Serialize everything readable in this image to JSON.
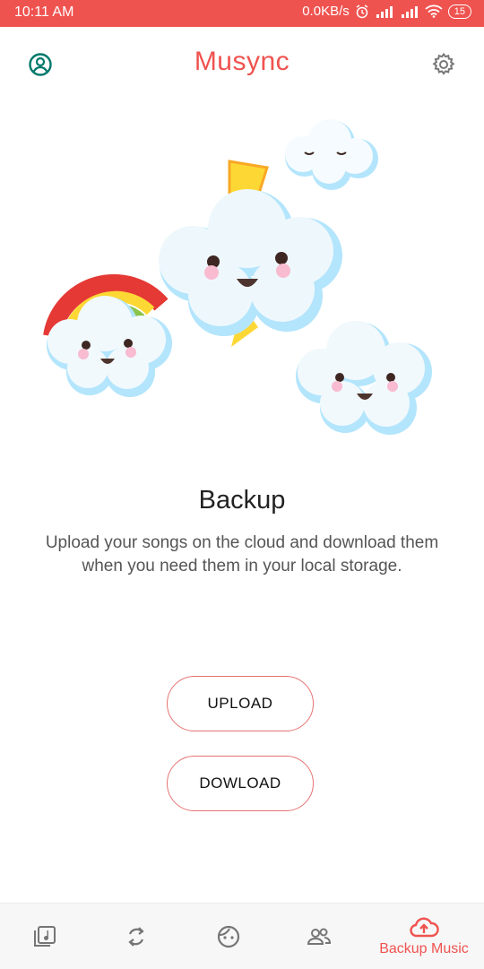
{
  "status_bar": {
    "time": "10:11 AM",
    "net_speed": "0.0KB/s",
    "battery": "15"
  },
  "app": {
    "title": "Musync",
    "accent": "#ef5350"
  },
  "main": {
    "heading": "Backup",
    "description": "Upload your songs on the cloud and download them when you need them in your local storage.",
    "upload_label": "UPLOAD",
    "download_label": "DOWLOAD"
  },
  "bottom_nav": {
    "items": [
      {
        "icon": "music-library-icon"
      },
      {
        "icon": "sync-icon"
      },
      {
        "icon": "face-icon"
      },
      {
        "icon": "people-icon"
      },
      {
        "icon": "cloud-upload-icon",
        "label": "Backup Music",
        "active": true
      }
    ]
  }
}
